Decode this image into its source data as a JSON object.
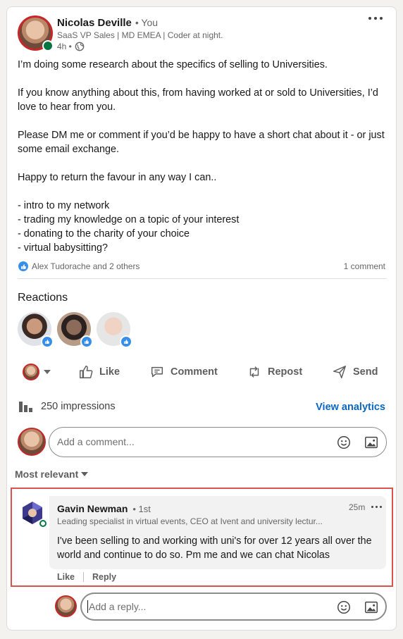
{
  "post": {
    "author_name": "Nicolas Deville",
    "author_relation": "• You",
    "author_headline": "SaaS VP Sales | MD EMEA | Coder at night.",
    "time": "4h •",
    "body": "I’m doing some research about the specifics of selling to Universities.\n\nIf you know anything about this, from having worked at or sold to Universities, I’d love to hear from you.\n\nPlease DM me or comment if you’d be happy to have a short chat about it - or just some email exchange.\n\nHappy to return the favour in any way I can..\n\n- intro to my network\n- trading my knowledge on a topic of your interest\n- donating to the charity of your choice\n- virtual babysitting?",
    "reactions_summary": "Alex Tudorache and 2 others",
    "comment_count": "1 comment"
  },
  "reactions": {
    "heading": "Reactions"
  },
  "actions": {
    "like": "Like",
    "comment": "Comment",
    "repost": "Repost",
    "send": "Send"
  },
  "analytics": {
    "impressions": "250 impressions",
    "view_link": "View analytics"
  },
  "comment_box": {
    "placeholder": "Add a comment..."
  },
  "sort": {
    "label": "Most relevant"
  },
  "comment": {
    "author": "Gavin Newman",
    "degree": "• 1st",
    "time": "25m",
    "headline": "Leading specialist in virtual events, CEO at Ivent and university lectur...",
    "text": "I've been selling to and working with uni's for over 12 years all over the world and continue to do so. Pm me and we can chat Nicolas",
    "like": "Like",
    "reply": "Reply"
  },
  "reply_box": {
    "placeholder": "Add a reply..."
  },
  "colors": {
    "link_blue": "#0a66c2",
    "like_blue": "#378fe9",
    "highlight_red": "#d9534f",
    "online_green": "#057642"
  }
}
